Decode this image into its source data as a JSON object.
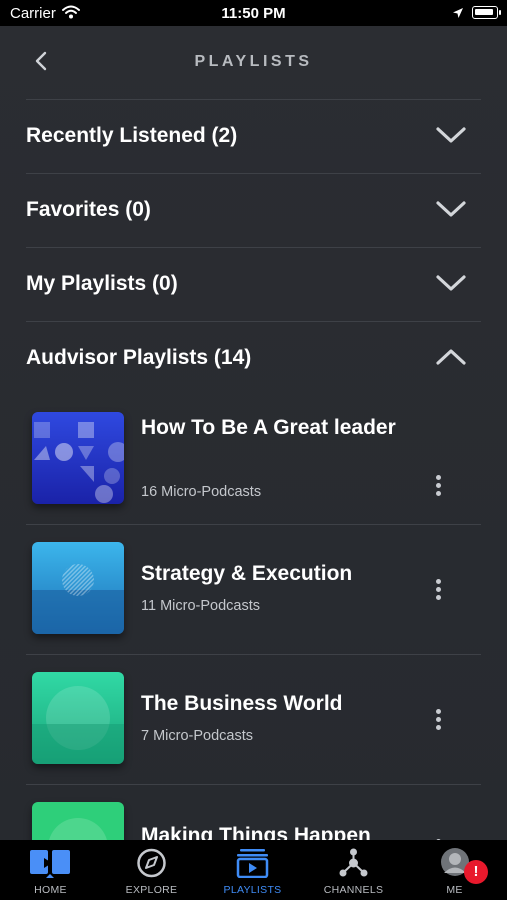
{
  "status_bar": {
    "carrier": "Carrier",
    "time": "11:50 PM"
  },
  "header": {
    "title": "PLAYLISTS",
    "back_icon": "chevron-left-icon"
  },
  "sections": [
    {
      "label": "Recently Listened (2)",
      "expanded": false
    },
    {
      "label": "Favorites (0)",
      "expanded": false
    },
    {
      "label": "My Playlists (0)",
      "expanded": false
    },
    {
      "label": "Audvisor Playlists (14)",
      "expanded": true
    }
  ],
  "playlists": [
    {
      "title": "How To Be A Great leader",
      "count": "16 Micro-Podcasts",
      "thumb_color": "#2336c9"
    },
    {
      "title": "Strategy & Execution",
      "count": "11 Micro-Podcasts",
      "thumb_color": "#2f9fd9"
    },
    {
      "title": "The Business World",
      "count": "7 Micro-Podcasts",
      "thumb_color": "#27c79a"
    },
    {
      "title": "Making Things Happen",
      "count": "",
      "thumb_color": "#2ecf7a"
    }
  ],
  "tabs": [
    {
      "label": "HOME",
      "icon": "home-icon",
      "active": false
    },
    {
      "label": "EXPLORE",
      "icon": "compass-icon",
      "active": false
    },
    {
      "label": "PLAYLISTS",
      "icon": "playlist-icon",
      "active": true
    },
    {
      "label": "CHANNELS",
      "icon": "network-icon",
      "active": false
    },
    {
      "label": "ME",
      "icon": "avatar-icon",
      "active": false,
      "badge": "!"
    }
  ],
  "colors": {
    "background": "#2a2c31",
    "accent": "#3f8cf6",
    "badge": "#e8192c"
  }
}
